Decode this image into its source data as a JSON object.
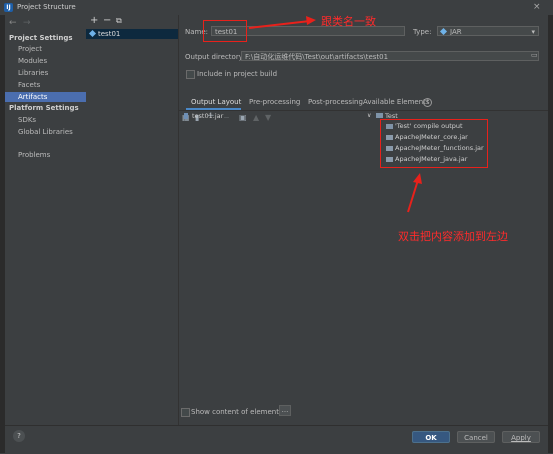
{
  "window": {
    "title": "Project Structure",
    "close_glyph": "×",
    "app_icon_letter": "IJ"
  },
  "nav": {
    "back": "←",
    "forward": "→"
  },
  "sidebar": {
    "project_settings_header": "Project Settings",
    "project_items": [
      "Project",
      "Modules",
      "Libraries",
      "Facets",
      "Artifacts"
    ],
    "platform_settings_header": "Platform Settings",
    "platform_items": [
      "SDKs",
      "Global Libraries"
    ],
    "problems": "Problems",
    "selected": "Artifacts"
  },
  "middle": {
    "toolbar": {
      "add": "+",
      "remove": "−",
      "copy": "⧉"
    },
    "artifact": "test01"
  },
  "form": {
    "name_label": "Name:",
    "name_value": "test01",
    "type_label": "Type:",
    "type_value": "JAR",
    "output_dir_label": "Output directory:",
    "output_dir_value": "F:\\自动化运维代码\\Test\\out\\artifacts\\test01",
    "include_build_label": "Include in project build"
  },
  "tabs": {
    "output_layout": "Output Layout",
    "pre_processing": "Pre-processing",
    "post_processing": "Post-processing"
  },
  "output": {
    "jar": "test01.jar",
    "available_label": "Available Elements",
    "help_glyph": "?"
  },
  "available": {
    "module": "Test",
    "items": [
      "'Test' compile output",
      "ApacheJMeter_core.jar",
      "ApacheJMeter_functions.jar",
      "ApacheJMeter_java.jar"
    ]
  },
  "footer": {
    "show_content_label": "Show content of elements",
    "ellipsis": "...",
    "ok": "OK",
    "cancel": "Cancel",
    "apply": "Apply",
    "help": "?"
  },
  "annotations": {
    "name_note": "跟类名一致",
    "elements_note": "双击把内容添加到左边",
    "color": "#e8211b"
  }
}
